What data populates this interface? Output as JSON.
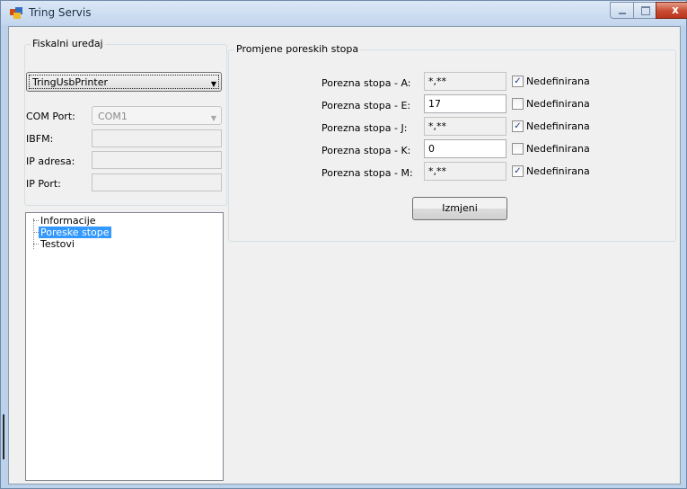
{
  "window": {
    "title": "Tring Servis",
    "close_glyph": "x"
  },
  "fiscal": {
    "group_label": "Fiskalni uređaj",
    "device_selected": "TringUsbPrinter",
    "com_label": "COM Port:",
    "com_value": "COM1",
    "ibfm_label": "IBFM:",
    "ip_label": "IP adresa:",
    "port_label": "IP Port:"
  },
  "tree": {
    "items": [
      "Informacije",
      "Poreske stope",
      "Testovi"
    ]
  },
  "rates": {
    "group_label": "Promjene poreskih stopa",
    "rows": [
      {
        "label": "Porezna stopa - A:",
        "value": "*,**",
        "checked": true,
        "check_label": "Nedefinirana"
      },
      {
        "label": "Porezna stopa - E:",
        "value": "17",
        "checked": false,
        "check_label": "Nedefinirana"
      },
      {
        "label": "Porezna stopa - J:",
        "value": "*,**",
        "checked": true,
        "check_label": "Nedefinirana"
      },
      {
        "label": "Porezna stopa - K:",
        "value": "0",
        "checked": false,
        "check_label": "Nedefinirana"
      },
      {
        "label": "Porezna stopa - M:",
        "value": "*,**",
        "checked": true,
        "check_label": "Nedefinirana"
      }
    ],
    "submit_label": "Izmjeni"
  }
}
